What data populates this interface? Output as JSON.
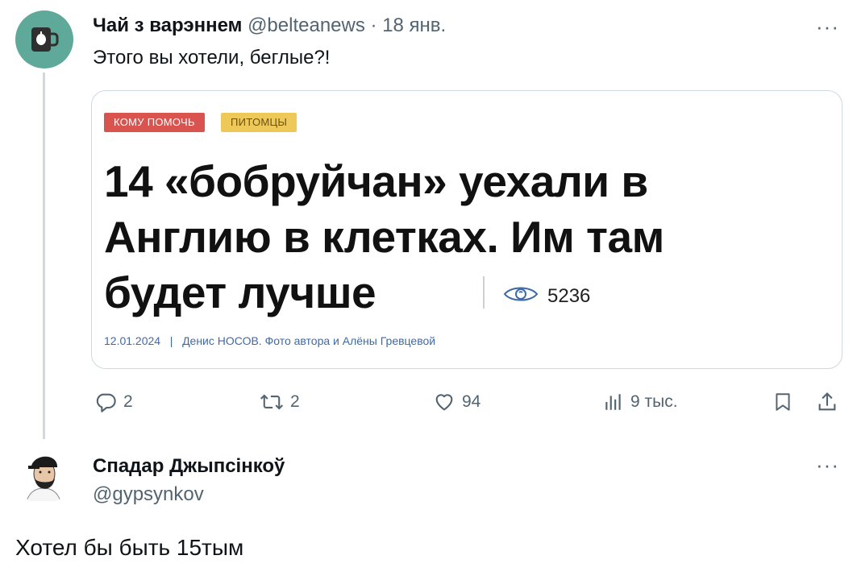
{
  "tweet1": {
    "display_name": "Чай з варэннем",
    "handle": "@belteanews",
    "dot": "·",
    "date": "18 янв.",
    "more": "···",
    "text": "Этого вы хотели, беглые?!",
    "card": {
      "tags": [
        "КОМУ ПОМОЧЬ",
        "ПИТОМЦЫ"
      ],
      "headline_lines": [
        "14 «бобруйчан» уехали в",
        "Англию в клетках. Им там",
        "будет лучше"
      ],
      "views": "5236",
      "byline_date": "12.01.2024",
      "byline_sep": "|",
      "byline_author": "Денис НОСОВ. Фото автора и Алёны Гревцевой"
    },
    "actions": {
      "replies": "2",
      "retweets": "2",
      "likes": "94",
      "views": "9 тыс."
    }
  },
  "tweet2": {
    "display_name": "Спадар Джыпсінкоў",
    "handle": "@gypsynkov",
    "more": "···",
    "text": "Хотел бы быть 15тым"
  },
  "colors": {
    "avatar1_bg": "#5fa99a",
    "tag1_bg": "#d9534f",
    "tag2_bg": "#eec95a",
    "secondary_text": "#536471",
    "thread_line": "#cfd9de"
  },
  "icons": {
    "reply": "reply-icon",
    "retweet": "retweet-icon",
    "like": "heart-icon",
    "views": "analytics-icon",
    "bookmark": "bookmark-icon",
    "share": "share-icon",
    "eye": "eye-icon"
  }
}
